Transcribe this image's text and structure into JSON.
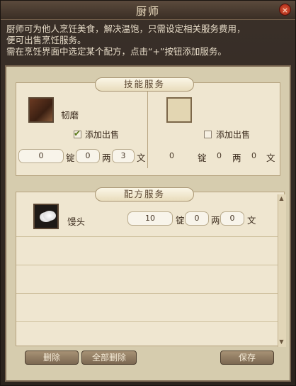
{
  "window": {
    "title": "厨师",
    "close_label": "×"
  },
  "description": [
    "  厨师可为他人烹饪美食，解决温饱，只需设定相关服务费用，",
    "便可出售烹饪服务。",
    "  需在烹饪界面中选定某个配方，点击“+”按钮添加服务。"
  ],
  "skill_section": {
    "header": "技能服务",
    "left": {
      "icon": "skill-item-icon",
      "name": "韧磨",
      "checkbox_label": "添加出售",
      "checked": true,
      "price": {
        "ding": "0",
        "liang": "0",
        "wen": "3"
      }
    },
    "right": {
      "icon": "empty-slot-icon",
      "checkbox_label": "添加出售",
      "checked": false,
      "price": {
        "ding": "0",
        "liang": "0",
        "wen": "0"
      }
    },
    "units": {
      "ding": "锭",
      "liang": "两",
      "wen": "文"
    }
  },
  "recipe_section": {
    "header": "配方服务",
    "rows": [
      {
        "icon": "steamed-bun-icon",
        "name": "馒头",
        "price": {
          "ding": "10",
          "liang": "0",
          "wen": "0"
        }
      }
    ]
  },
  "buttons": {
    "delete": "删除",
    "delete_all": "全部删除",
    "save": "保存"
  }
}
